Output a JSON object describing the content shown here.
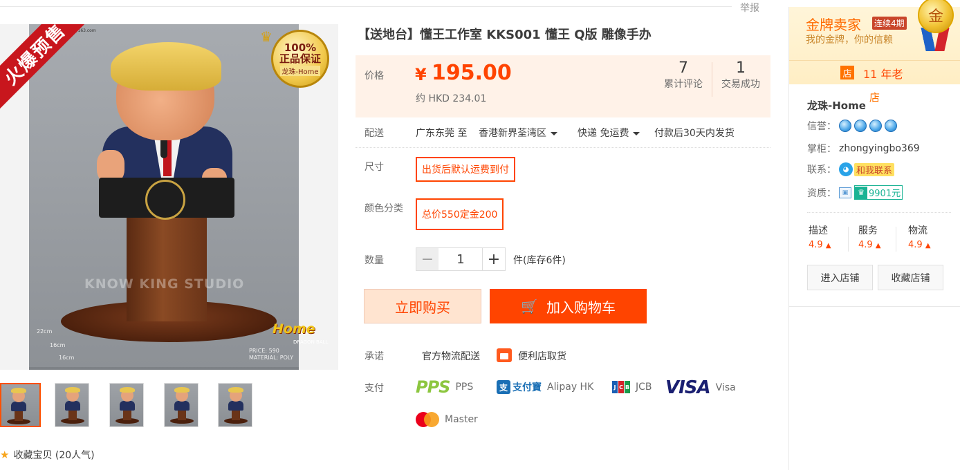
{
  "header": {
    "report_label": "举报"
  },
  "gallery": {
    "presale_ribbon": "火爆预售",
    "badge_percent": "100%",
    "badge_text": "正品保证",
    "badge_shop": "龙珠-Home",
    "email": "rdio@163.com",
    "watermark": "KNOW KING STUDIO",
    "dims": [
      "22cm",
      "16cm",
      "16cm"
    ],
    "spec_price": "PRICE: 590",
    "spec_material": "MATERIAL: POLY",
    "logo_main": "Home",
    "logo_sub": "DRAGON BALL",
    "favorite_label": "收藏宝贝 (20人气)"
  },
  "product": {
    "title": "【送地台】懂王工作室 KKS001 懂王 Q版 雕像手办",
    "price_label": "价格",
    "currency": "¥",
    "price": "195.00",
    "price_hkd": "约 HKD 234.01",
    "reviews_count": "7",
    "reviews_label": "累计评论",
    "sold_count": "1",
    "sold_label": "交易成功",
    "shipping_label": "配送",
    "ship_from": "广东东莞 至",
    "ship_to": "香港新界荃湾区",
    "ship_method": "快递 免运费",
    "ship_time": "付款后30天内发货",
    "size_label": "尺寸",
    "size_option": "出货后默认运费到付",
    "color_label": "颜色分类",
    "color_option": "总价550定金200",
    "qty_label": "数量",
    "qty_minus": "−",
    "qty_value": "1",
    "qty_plus": "+",
    "stock": "件(库存6件)",
    "buy_now": "立即购买",
    "add_cart": "加入购物车",
    "promise_label": "承诺",
    "promise_1": "官方物流配送",
    "promise_2": "便利店取货",
    "pay_label": "支付",
    "payments": {
      "pps_logo": "PPS",
      "pps": "PPS",
      "alipay_logo": "支付寶",
      "alipay": "Alipay HK",
      "jcb": "JCB",
      "visa_logo": "VISA",
      "visa": "Visa",
      "mastercard": "Master"
    }
  },
  "seller": {
    "gold_title": "金牌卖家",
    "streak": "连续4期",
    "gold_sub": "我的金牌，你的信赖",
    "medal": "金",
    "shop_tag": "店",
    "years": "11 年老",
    "shop_name": "龙珠-Home",
    "shop_sup": "店",
    "credit_label": "信誉：",
    "keeper_label": "掌柜：",
    "keeper": "zhongyingbo369",
    "contact_label": "联系：",
    "contact_btn": "和我联系",
    "qualify_label": "资质：",
    "deposit": "9901元",
    "scores": [
      {
        "label": "描述",
        "value": "4.9"
      },
      {
        "label": "服务",
        "value": "4.9"
      },
      {
        "label": "物流",
        "value": "4.9"
      }
    ],
    "enter_shop": "进入店铺",
    "fav_shop": "收藏店铺"
  },
  "colors": {
    "accent": "#ff4400",
    "price_bg": "#fff2e8",
    "gold": "#ff6a00"
  }
}
